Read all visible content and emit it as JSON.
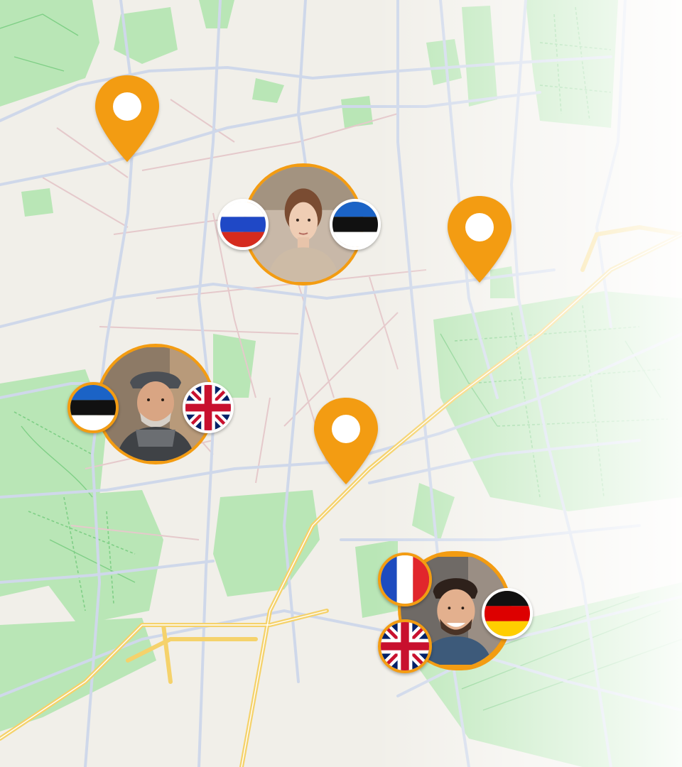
{
  "map": {
    "colors": {
      "land": "#f1efe9",
      "park": "#b9e6b6",
      "road": "#cfd8ea",
      "road_minor": "#e5c9cb",
      "highway": "#f5d26b",
      "park_path": "#7fcf86",
      "accent": "#f39c12"
    },
    "pins": [
      {
        "id": "pin-1",
        "icon": "location-pin-icon"
      },
      {
        "id": "pin-2",
        "icon": "location-pin-icon"
      },
      {
        "id": "pin-3",
        "icon": "location-pin-icon"
      }
    ],
    "users": [
      {
        "id": "user-woman",
        "flags": [
          "russia",
          "estonia"
        ]
      },
      {
        "id": "user-elderly-man",
        "flags": [
          "estonia",
          "united-kingdom"
        ]
      },
      {
        "id": "user-young-man",
        "flags": [
          "france",
          "germany",
          "united-kingdom"
        ]
      }
    ]
  }
}
